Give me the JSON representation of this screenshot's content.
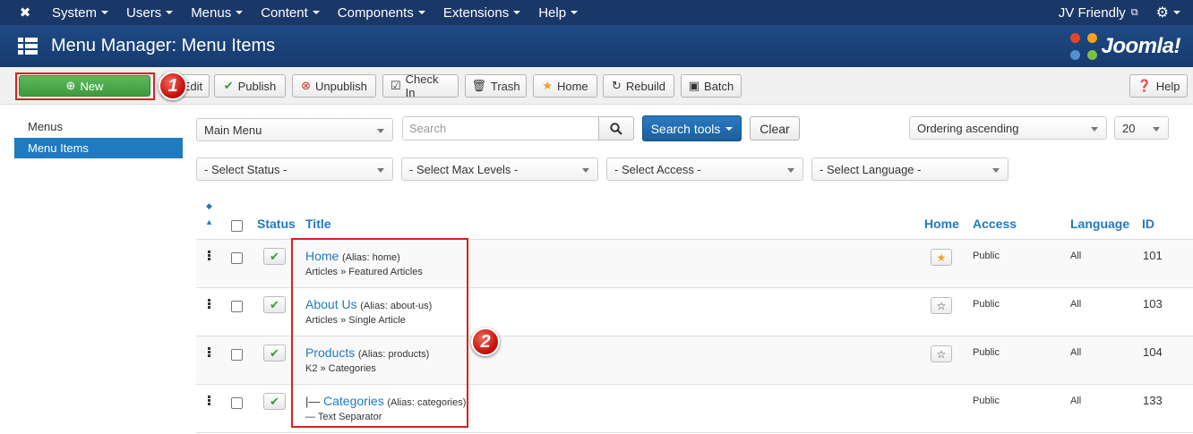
{
  "navbar": {
    "menus": [
      "System",
      "Users",
      "Menus",
      "Content",
      "Components",
      "Extensions",
      "Help"
    ],
    "user": "JV Friendly"
  },
  "header": {
    "title": "Menu Manager: Menu Items",
    "brand": "Joomla!"
  },
  "toolbar": {
    "new": "New",
    "edit": "Edit",
    "publish": "Publish",
    "unpublish": "Unpublish",
    "checkin": "Check In",
    "trash": "Trash",
    "home": "Home",
    "rebuild": "Rebuild",
    "batch": "Batch",
    "help": "Help"
  },
  "callouts": [
    "1",
    "2"
  ],
  "sidebar": {
    "items": [
      {
        "label": "Menus",
        "active": false
      },
      {
        "label": "Menu Items",
        "active": true
      }
    ]
  },
  "filters": {
    "menu": "Main Menu",
    "search_placeholder": "Search",
    "search_tools": "Search tools",
    "clear": "Clear",
    "ordering": "Ordering ascending",
    "limit": "20",
    "status": "- Select Status -",
    "max_levels": "- Select Max Levels -",
    "access": "- Select Access -",
    "language": "- Select Language -"
  },
  "table": {
    "headers": {
      "status": "Status",
      "title": "Title",
      "home": "Home",
      "access": "Access",
      "language": "Language",
      "id": "ID"
    },
    "rows": [
      {
        "prefix": "",
        "title": "Home",
        "alias": "(Alias: home)",
        "type": "Articles » Featured Articles",
        "home": "default",
        "access": "Public",
        "language": "All",
        "id": "101"
      },
      {
        "prefix": "",
        "title": "About Us",
        "alias": "(Alias: about-us)",
        "type": "Articles » Single Article",
        "home": "not-default",
        "access": "Public",
        "language": "All",
        "id": "103"
      },
      {
        "prefix": "",
        "title": "Products",
        "alias": "(Alias: products)",
        "type": "K2 » Categories",
        "home": "not-default",
        "access": "Public",
        "language": "All",
        "id": "104"
      },
      {
        "prefix": "|—",
        "title": "Categories",
        "alias": "(Alias: categories)",
        "type": "— Text Separator",
        "home": "none",
        "access": "Public",
        "language": "All",
        "id": "133"
      }
    ]
  }
}
